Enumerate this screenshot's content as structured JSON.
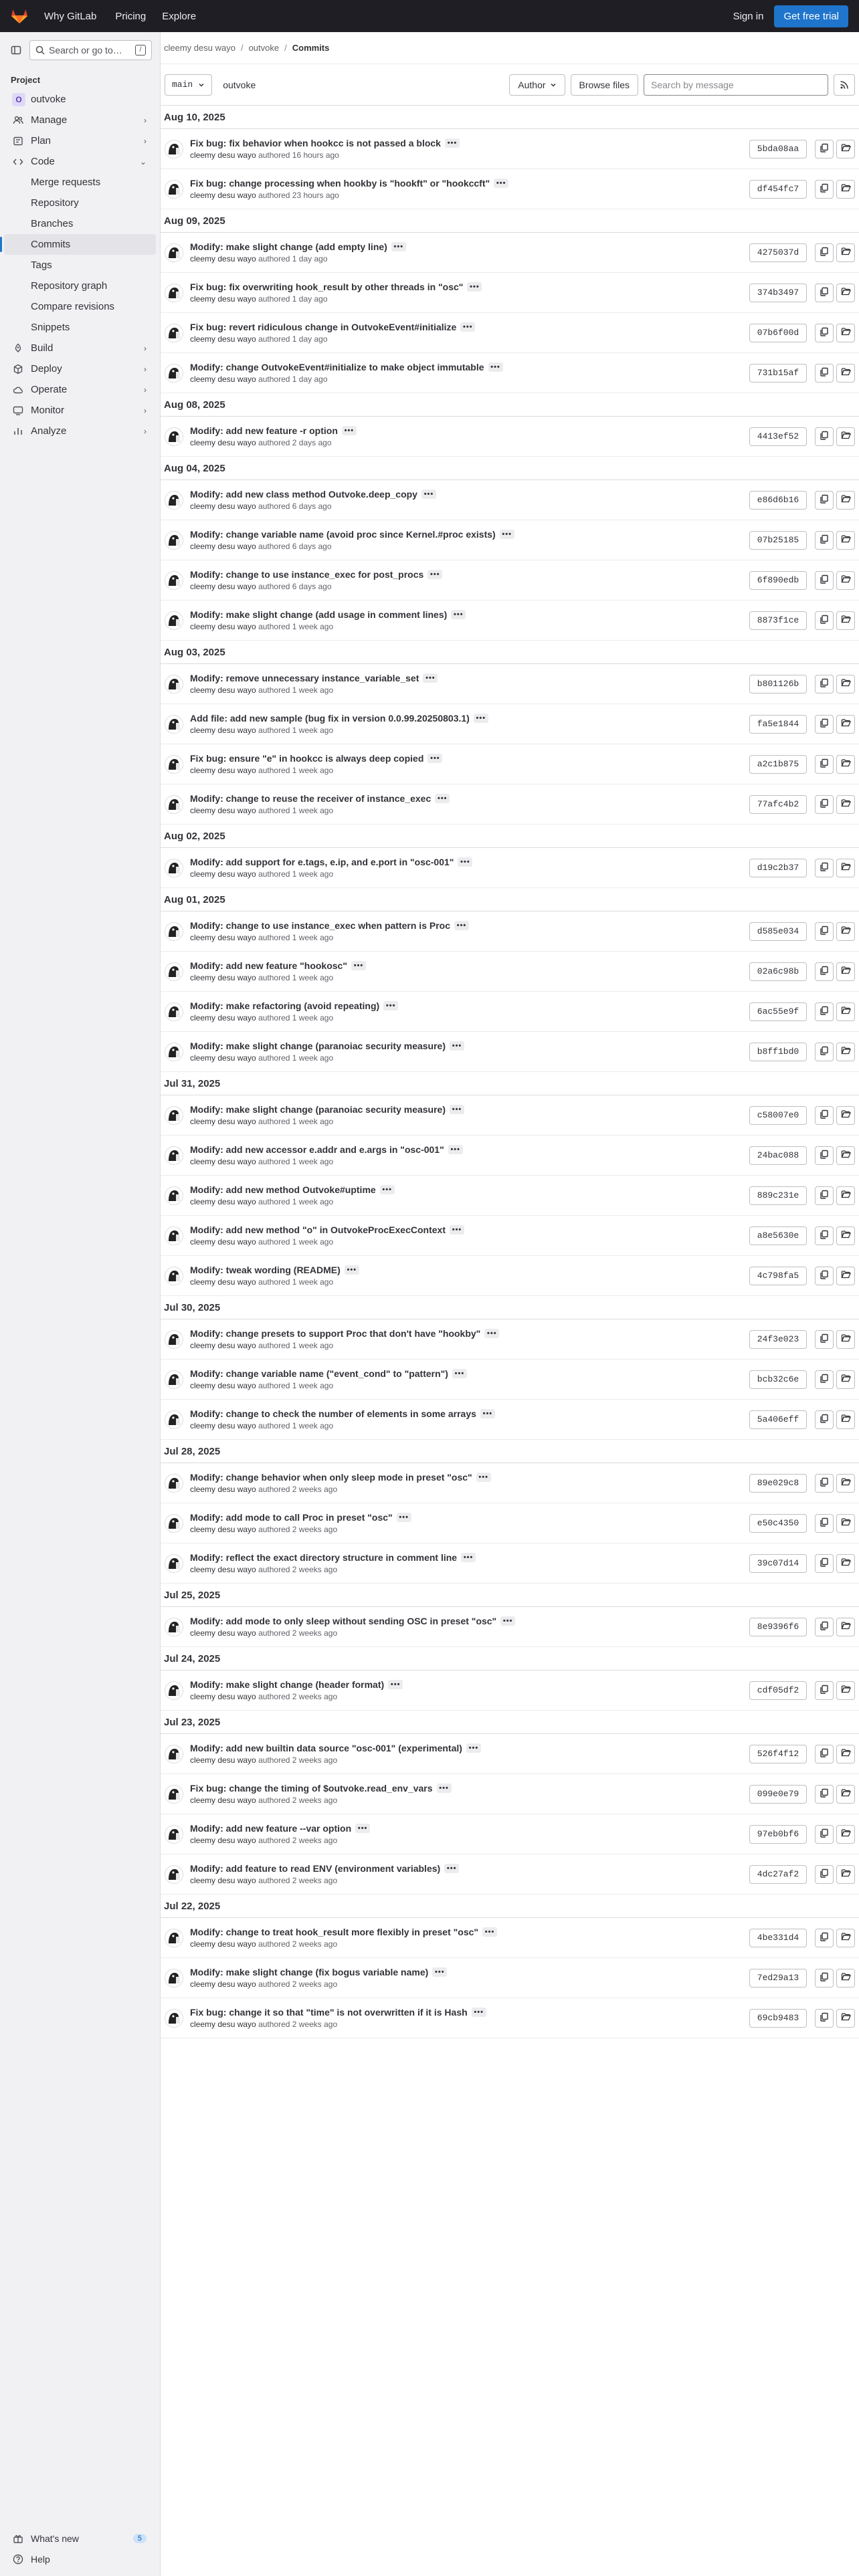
{
  "topbar": {
    "nav": [
      "Why GitLab",
      "Pricing",
      "Explore"
    ],
    "signin": "Sign in",
    "trial": "Get free trial"
  },
  "sidebar": {
    "search_placeholder": "Search or go to…",
    "section": "Project",
    "project_initial": "O",
    "project_name": "outvoke",
    "items": [
      {
        "label": "Manage"
      },
      {
        "label": "Plan"
      },
      {
        "label": "Code"
      }
    ],
    "code_sub": [
      "Merge requests",
      "Repository",
      "Branches",
      "Commits",
      "Tags",
      "Repository graph",
      "Compare revisions",
      "Snippets"
    ],
    "more_items": [
      {
        "label": "Build"
      },
      {
        "label": "Deploy"
      },
      {
        "label": "Operate"
      },
      {
        "label": "Monitor"
      },
      {
        "label": "Analyze"
      }
    ],
    "whats_new": "What's new",
    "whats_new_count": "5",
    "help": "Help"
  },
  "breadcrumb": [
    "cleemy desu wayo",
    "outvoke",
    "Commits"
  ],
  "filterbar": {
    "branch": "main",
    "path": "outvoke",
    "author_btn": "Author",
    "browse_btn": "Browse files",
    "search_placeholder": "Search by message"
  },
  "groups": [
    {
      "date": "Aug 10, 2025",
      "commits": [
        {
          "title": "Fix bug: fix behavior when hookcc is not passed a block",
          "author": "cleemy desu wayo",
          "time": "16 hours ago",
          "sha": "5bda08aa"
        },
        {
          "title": "Fix bug: change processing when hookby is \"hookft\" or \"hookccft\"",
          "author": "cleemy desu wayo",
          "time": "23 hours ago",
          "sha": "df454fc7"
        }
      ]
    },
    {
      "date": "Aug 09, 2025",
      "commits": [
        {
          "title": "Modify: make slight change (add empty line)",
          "author": "cleemy desu wayo",
          "time": "1 day ago",
          "sha": "4275037d"
        },
        {
          "title": "Fix bug: fix overwriting hook_result by other threads in \"osc\"",
          "author": "cleemy desu wayo",
          "time": "1 day ago",
          "sha": "374b3497"
        },
        {
          "title": "Fix bug: revert ridiculous change in OutvokeEvent#initialize",
          "author": "cleemy desu wayo",
          "time": "1 day ago",
          "sha": "07b6f00d"
        },
        {
          "title": "Modify: change OutvokeEvent#initialize to make object immutable",
          "author": "cleemy desu wayo",
          "time": "1 day ago",
          "sha": "731b15af"
        }
      ]
    },
    {
      "date": "Aug 08, 2025",
      "commits": [
        {
          "title": "Modify: add new feature -r option",
          "author": "cleemy desu wayo",
          "time": "2 days ago",
          "sha": "4413ef52"
        }
      ]
    },
    {
      "date": "Aug 04, 2025",
      "commits": [
        {
          "title": "Modify: add new class method Outvoke.deep_copy",
          "author": "cleemy desu wayo",
          "time": "6 days ago",
          "sha": "e86d6b16"
        },
        {
          "title": "Modify: change variable name (avoid proc since Kernel.#proc exists)",
          "author": "cleemy desu wayo",
          "time": "6 days ago",
          "sha": "07b25185"
        },
        {
          "title": "Modify: change to use instance_exec for post_procs",
          "author": "cleemy desu wayo",
          "time": "6 days ago",
          "sha": "6f890edb"
        },
        {
          "title": "Modify: make slight change (add usage in comment lines)",
          "author": "cleemy desu wayo",
          "time": "1 week ago",
          "sha": "8873f1ce"
        }
      ]
    },
    {
      "date": "Aug 03, 2025",
      "commits": [
        {
          "title": "Modify: remove unnecessary instance_variable_set",
          "author": "cleemy desu wayo",
          "time": "1 week ago",
          "sha": "b801126b"
        },
        {
          "title": "Add file: add new sample (bug fix in version 0.0.99.20250803.1)",
          "author": "cleemy desu wayo",
          "time": "1 week ago",
          "sha": "fa5e1844"
        },
        {
          "title": "Fix bug: ensure \"e\" in hookcc is always deep copied",
          "author": "cleemy desu wayo",
          "time": "1 week ago",
          "sha": "a2c1b875"
        },
        {
          "title": "Modify: change to reuse the receiver of instance_exec",
          "author": "cleemy desu wayo",
          "time": "1 week ago",
          "sha": "77afc4b2"
        }
      ]
    },
    {
      "date": "Aug 02, 2025",
      "commits": [
        {
          "title": "Modify: add support for e.tags, e.ip, and e.port in \"osc-001\"",
          "author": "cleemy desu wayo",
          "time": "1 week ago",
          "sha": "d19c2b37"
        }
      ]
    },
    {
      "date": "Aug 01, 2025",
      "commits": [
        {
          "title": "Modify: change to use instance_exec when pattern is Proc",
          "author": "cleemy desu wayo",
          "time": "1 week ago",
          "sha": "d585e034"
        },
        {
          "title": "Modify: add new feature \"hookosc\"",
          "author": "cleemy desu wayo",
          "time": "1 week ago",
          "sha": "02a6c98b"
        },
        {
          "title": "Modify: make refactoring (avoid repeating)",
          "author": "cleemy desu wayo",
          "time": "1 week ago",
          "sha": "6ac55e9f"
        },
        {
          "title": "Modify: make slight change (paranoiac security measure)",
          "author": "cleemy desu wayo",
          "time": "1 week ago",
          "sha": "b8ff1bd0"
        }
      ]
    },
    {
      "date": "Jul 31, 2025",
      "commits": [
        {
          "title": "Modify: make slight change (paranoiac security measure)",
          "author": "cleemy desu wayo",
          "time": "1 week ago",
          "sha": "c58007e0"
        },
        {
          "title": "Modify: add new accessor e.addr and e.args in \"osc-001\"",
          "author": "cleemy desu wayo",
          "time": "1 week ago",
          "sha": "24bac088"
        },
        {
          "title": "Modify: add new method Outvoke#uptime",
          "author": "cleemy desu wayo",
          "time": "1 week ago",
          "sha": "889c231e"
        },
        {
          "title": "Modify: add new method \"o\" in OutvokeProcExecContext",
          "author": "cleemy desu wayo",
          "time": "1 week ago",
          "sha": "a8e5630e"
        },
        {
          "title": "Modify: tweak wording (README)",
          "author": "cleemy desu wayo",
          "time": "1 week ago",
          "sha": "4c798fa5"
        }
      ]
    },
    {
      "date": "Jul 30, 2025",
      "commits": [
        {
          "title": "Modify: change presets to support Proc that don't have \"hookby\"",
          "author": "cleemy desu wayo",
          "time": "1 week ago",
          "sha": "24f3e023"
        },
        {
          "title": "Modify: change variable name (\"event_cond\" to \"pattern\")",
          "author": "cleemy desu wayo",
          "time": "1 week ago",
          "sha": "bcb32c6e"
        },
        {
          "title": "Modify: change to check the number of elements in some arrays",
          "author": "cleemy desu wayo",
          "time": "1 week ago",
          "sha": "5a406eff"
        }
      ]
    },
    {
      "date": "Jul 28, 2025",
      "commits": [
        {
          "title": "Modify: change behavior when only sleep mode in preset \"osc\"",
          "author": "cleemy desu wayo",
          "time": "2 weeks ago",
          "sha": "89e029c8"
        },
        {
          "title": "Modify: add mode to call Proc in preset \"osc\"",
          "author": "cleemy desu wayo",
          "time": "2 weeks ago",
          "sha": "e50c4350"
        },
        {
          "title": "Modify: reflect the exact directory structure in comment line",
          "author": "cleemy desu wayo",
          "time": "2 weeks ago",
          "sha": "39c07d14"
        }
      ]
    },
    {
      "date": "Jul 25, 2025",
      "commits": [
        {
          "title": "Modify: add mode to only sleep without sending OSC in preset \"osc\"",
          "author": "cleemy desu wayo",
          "time": "2 weeks ago",
          "sha": "8e9396f6"
        }
      ]
    },
    {
      "date": "Jul 24, 2025",
      "commits": [
        {
          "title": "Modify: make slight change (header format)",
          "author": "cleemy desu wayo",
          "time": "2 weeks ago",
          "sha": "cdf05df2"
        }
      ]
    },
    {
      "date": "Jul 23, 2025",
      "commits": [
        {
          "title": "Modify: add new builtin data source \"osc-001\" (experimental)",
          "author": "cleemy desu wayo",
          "time": "2 weeks ago",
          "sha": "526f4f12"
        },
        {
          "title": "Fix bug: change the timing of $outvoke.read_env_vars",
          "author": "cleemy desu wayo",
          "time": "2 weeks ago",
          "sha": "099e0e79"
        },
        {
          "title": "Modify: add new feature --var option",
          "author": "cleemy desu wayo",
          "time": "2 weeks ago",
          "sha": "97eb0bf6"
        },
        {
          "title": "Modify: add feature to read ENV (environment variables)",
          "author": "cleemy desu wayo",
          "time": "2 weeks ago",
          "sha": "4dc27af2"
        }
      ]
    },
    {
      "date": "Jul 22, 2025",
      "commits": [
        {
          "title": "Modify: change to treat hook_result more flexibly in preset \"osc\"",
          "author": "cleemy desu wayo",
          "time": "2 weeks ago",
          "sha": "4be331d4"
        },
        {
          "title": "Modify: make slight change (fix bogus variable name)",
          "author": "cleemy desu wayo",
          "time": "2 weeks ago",
          "sha": "7ed29a13"
        },
        {
          "title": "Fix bug: change it so that \"time\" is not overwritten if it is Hash",
          "author": "cleemy desu wayo",
          "time": "2 weeks ago",
          "sha": "69cb9483"
        }
      ]
    }
  ],
  "authored_word": "authored",
  "icons": {
    "copy": "copy-icon",
    "folder": "folder-open-icon",
    "rss": "rss-icon"
  },
  "colors": {
    "topbar": "#1f1e24",
    "accent": "#1f75cb",
    "sidebar_bg": "#f1f1f3",
    "logo": "#e24329"
  }
}
